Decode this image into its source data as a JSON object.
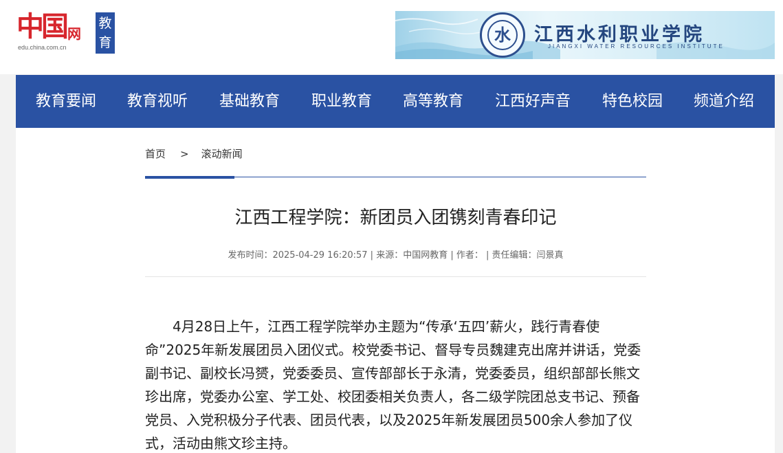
{
  "header": {
    "logo_text": "中国网",
    "logo_url": "edu.china.com.cn",
    "logo_badge": "教育",
    "banner": {
      "title": "江西水利职业学院",
      "subtitle": "JIANGXI WATER RESOURCES INSTITUTE",
      "seal_icon": "college-seal-icon"
    }
  },
  "nav": {
    "items": [
      "教育要闻",
      "教育视听",
      "基础教育",
      "职业教育",
      "高等教育",
      "江西好声音",
      "特色校园",
      "频道介绍"
    ]
  },
  "breadcrumb": {
    "home": "首页",
    "separator": ">",
    "current": "滚动新闻"
  },
  "article": {
    "title": "江西工程学院：新团员入团镌刻青春印记",
    "meta": "发布时间：2025-04-29 16:20:57 | 来源：中国网教育 | 作者：  | 责任编辑：闫景真",
    "paragraph1": "4月28日上午，江西工程学院举办主题为“传承‘五四’薪火，践行青春使命”2025年新发展团员入团仪式。校党委书记、督导专员魏建克出席并讲话，党委副书记、副校长冯赟，党委委员、宣传部部长于永清，党委委员，组织部部长熊文珍出席，党委办公室、学工处、校团委相关负责人，各二级学院团总支书记、预备党员、入党积极分子代表、团员代表，以及2025年新发展团员500余人参加了仪式，活动由熊文珍主持。"
  },
  "colors": {
    "brand_blue": "#2a52a3",
    "logo_red": "#d7262d",
    "background": "#f2f2f2"
  }
}
